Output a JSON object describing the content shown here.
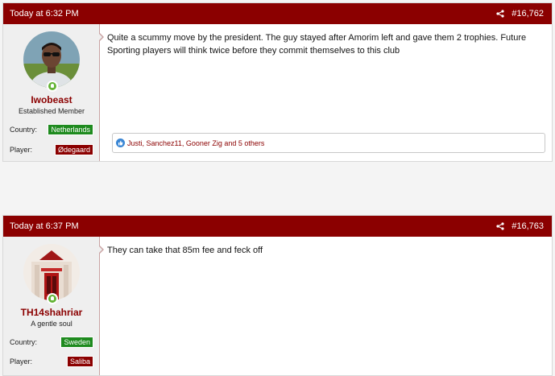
{
  "posts": [
    {
      "date": "Today at 6:32 PM",
      "number": "#16,762",
      "username": "Iwobeast",
      "user_title": "Established Member",
      "fields": [
        {
          "label": "Country:",
          "value": "Netherlands",
          "color": "#1e8a1e"
        },
        {
          "label": "Player:",
          "value": "Ødegaard",
          "color": "#8b0000"
        }
      ],
      "message": "Quite a scummy move by the president. The guy stayed after Amorim left and gave them 2 trophies. Future Sporting players will think twice before they commit themselves to this club",
      "reactions": "Justi, Sanchez11, Gooner Zig and 5 others"
    },
    {
      "date": "Today at 6:37 PM",
      "number": "#16,763",
      "username": "TH14shahriar",
      "user_title": "A gentle soul",
      "fields": [
        {
          "label": "Country:",
          "value": "Sweden",
          "color": "#1e8a1e"
        },
        {
          "label": "Player:",
          "value": "Saliba",
          "color": "#8b0000"
        }
      ],
      "message": "They can take that 85m fee and feck off"
    }
  ],
  "icons": {
    "share": "share-icon",
    "online": "online-indicator-icon",
    "like": "like-reaction-icon"
  },
  "colors": {
    "header": "#8b0000",
    "accent_red": "#8b0000",
    "green": "#1e8a1e"
  }
}
